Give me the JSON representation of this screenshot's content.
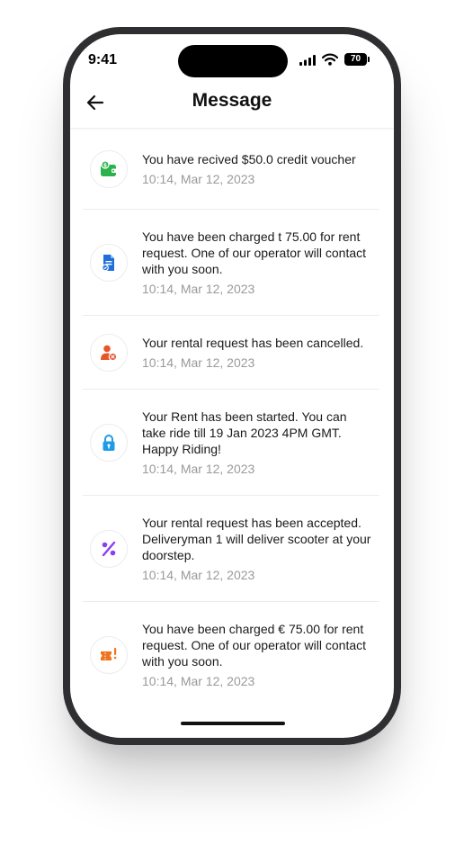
{
  "status_bar": {
    "time": "9:41",
    "battery": "70"
  },
  "header": {
    "title": "Message"
  },
  "messages": [
    {
      "text": "You have recived $50.0 credit voucher",
      "time": "10:14, Mar 12, 2023",
      "icon": "wallet-icon",
      "color": "#2bb24c"
    },
    {
      "text": "You have been charged t 75.00 for rent request. One of our operator will contact with you soon.",
      "time": "10:14, Mar 12, 2023",
      "icon": "document-icon",
      "color": "#1e6fd9"
    },
    {
      "text": "Your rental request has been cancelled.",
      "time": "10:14, Mar 12, 2023",
      "icon": "user-cancel-icon",
      "color": "#e8542a"
    },
    {
      "text": "Your Rent has been started. You can take ride till 19 Jan 2023 4PM GMT. Happy Riding!",
      "time": "10:14, Mar 12, 2023",
      "icon": "lock-icon",
      "color": "#1e9be8"
    },
    {
      "text": "Your rental request has been accepted. Deliveryman 1 will deliver scooter at your doorstep.",
      "time": "10:14, Mar 12, 2023",
      "icon": "percent-icon",
      "color": "#8a3ff0"
    },
    {
      "text": "You have been charged € 75.00 for rent request. One of our operator will contact with you soon.",
      "time": "10:14, Mar 12, 2023",
      "icon": "ticket-alert-icon",
      "color": "#f0741e"
    }
  ]
}
